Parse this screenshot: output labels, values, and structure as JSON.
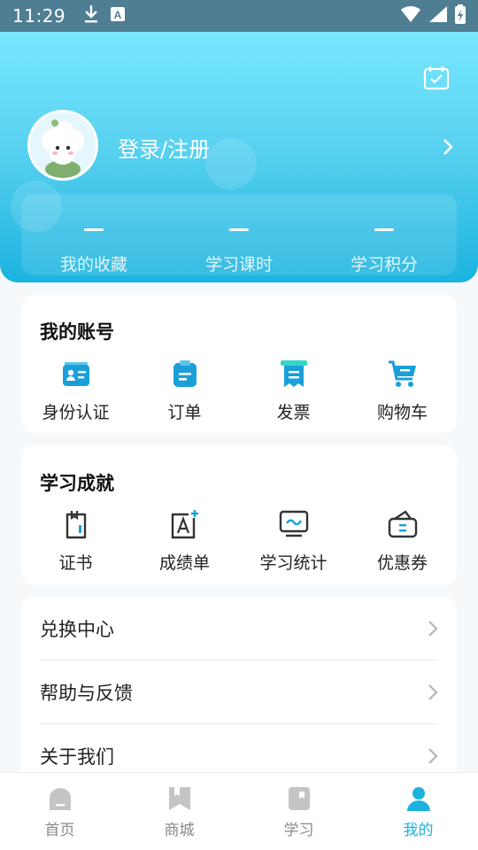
{
  "status_bar": {
    "time": "11:29",
    "icons": [
      "download-icon",
      "a-badge-icon",
      "wifi-icon",
      "signal-icon",
      "battery-icon"
    ],
    "a_badge": "A"
  },
  "header": {
    "login_label": "登录/注册",
    "calendar_icon": "calendar-check-icon",
    "stats": [
      {
        "value": "—",
        "label": "我的收藏"
      },
      {
        "value": "—",
        "label": "学习课时"
      },
      {
        "value": "—",
        "label": "学习积分"
      }
    ]
  },
  "account": {
    "title": "我的账号",
    "items": [
      {
        "label": "身份认证",
        "icon": "id-card-icon"
      },
      {
        "label": "订单",
        "icon": "order-clipboard-icon"
      },
      {
        "label": "发票",
        "icon": "invoice-icon"
      },
      {
        "label": "购物车",
        "icon": "shopping-cart-icon"
      }
    ]
  },
  "achievements": {
    "title": "学习成就",
    "items": [
      {
        "label": "证书",
        "icon": "certificate-icon"
      },
      {
        "label": "成绩单",
        "icon": "grade-report-icon"
      },
      {
        "label": "学习统计",
        "icon": "statistics-monitor-icon"
      },
      {
        "label": "优惠券",
        "icon": "coupon-wallet-icon"
      }
    ]
  },
  "menu": [
    {
      "label": "兑换中心"
    },
    {
      "label": "帮助与反馈"
    },
    {
      "label": "关于我们"
    }
  ],
  "bottom_nav": [
    {
      "label": "首页",
      "icon": "home-icon",
      "active": false
    },
    {
      "label": "商城",
      "icon": "mall-icon",
      "active": false
    },
    {
      "label": "学习",
      "icon": "study-book-icon",
      "active": false
    },
    {
      "label": "我的",
      "icon": "profile-icon",
      "active": true
    }
  ],
  "colors": {
    "accent": "#1ab3df",
    "header_top": "#78e8ff",
    "header_bottom": "#1ab3df",
    "icon_blue": "#1a9fd9",
    "inactive": "#bbbbbb"
  }
}
